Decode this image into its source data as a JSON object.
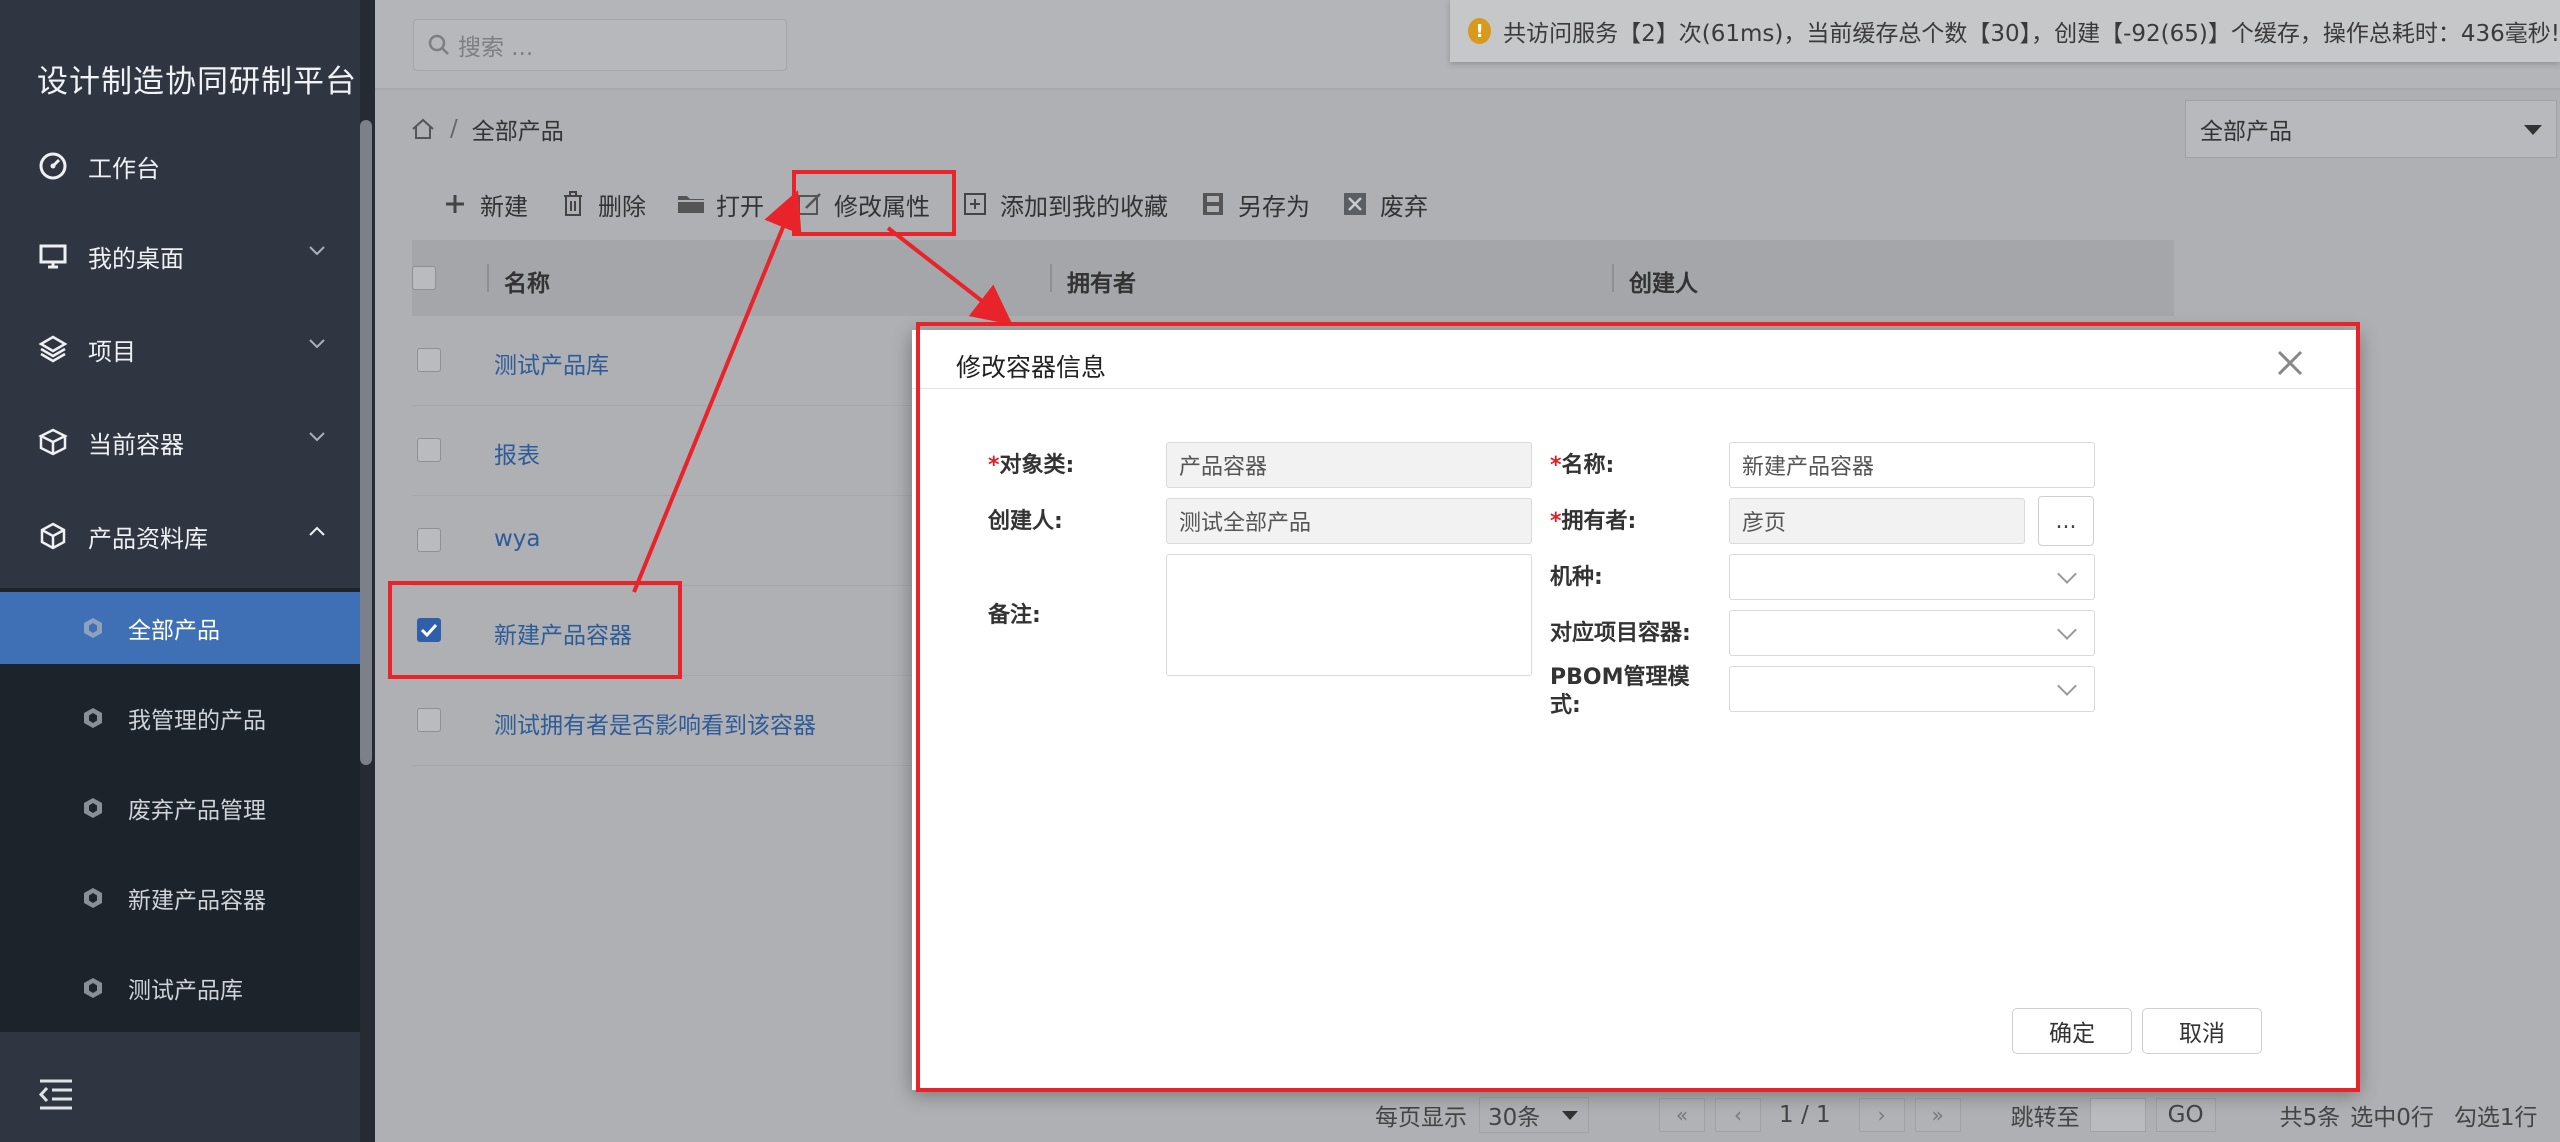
{
  "app": {
    "title": "设计制造协同研制平台"
  },
  "search": {
    "placeholder": "搜索 ..."
  },
  "notice": {
    "icon": "warning-icon",
    "text": "共访问服务【2】次(61ms)，当前缓存总个数【30】，创建【-92(65)】个缓存，操作总耗时：436毫秒!"
  },
  "sidebar": {
    "items": [
      {
        "label": "工作台",
        "icon": "dashboard-icon"
      },
      {
        "label": "我的桌面",
        "icon": "monitor-icon"
      },
      {
        "label": "项目",
        "icon": "layers-icon"
      },
      {
        "label": "当前容器",
        "icon": "boxes-icon"
      },
      {
        "label": "产品资料库",
        "icon": "cube-icon"
      }
    ],
    "subitems": [
      {
        "label": "全部产品"
      },
      {
        "label": "我管理的产品"
      },
      {
        "label": "废弃产品管理"
      },
      {
        "label": "新建产品容器"
      },
      {
        "label": "测试产品库"
      }
    ]
  },
  "breadcrumb": {
    "home_icon": "home-icon",
    "current": "全部产品"
  },
  "container_select": {
    "value": "全部产品"
  },
  "toolbar": {
    "new": "新建",
    "delete": "删除",
    "open": "打开",
    "edit": "修改属性",
    "favorite": "添加到我的收藏",
    "save_as": "另存为",
    "discard": "废弃"
  },
  "table": {
    "columns": [
      "名称",
      "拥有者",
      "创建人"
    ],
    "rows": [
      {
        "name": "测试产品库",
        "checked": false
      },
      {
        "name": "报表",
        "checked": false
      },
      {
        "name": "wya",
        "checked": false
      },
      {
        "name": "新建产品容器",
        "checked": true
      },
      {
        "name": "测试拥有者是否影响看到该容器",
        "checked": false
      }
    ]
  },
  "pager": {
    "per_page_label": "每页显示",
    "per_page": "30条",
    "page_info": "1 / 1",
    "jump_label": "跳转至",
    "go": "GO",
    "total": "共5条",
    "selected": "选中0行",
    "checked": "勾选1行"
  },
  "modal": {
    "title": "修改容器信息",
    "fields": {
      "object_class": {
        "label": "对象类:",
        "value": "产品容器",
        "required": true
      },
      "name": {
        "label": "名称:",
        "value": "新建产品容器",
        "required": true
      },
      "creator": {
        "label": "创建人:",
        "value": "测试全部产品"
      },
      "owner": {
        "label": "拥有者:",
        "value": "彦页",
        "required": true
      },
      "owner_button": "...",
      "remark": {
        "label": "备注:",
        "value": ""
      },
      "model": {
        "label": "机种:",
        "value": ""
      },
      "project_container": {
        "label": "对应项目容器:",
        "value": ""
      },
      "pbom_mode": {
        "label_line1": "PBOM管理模",
        "label_line2": "式:",
        "value": ""
      }
    },
    "required_mark": "*",
    "confirm": "确定",
    "cancel": "取消"
  },
  "colors": {
    "accent": "#3f6fb4",
    "annotation": "#e8232a",
    "link": "#2e5c99"
  }
}
